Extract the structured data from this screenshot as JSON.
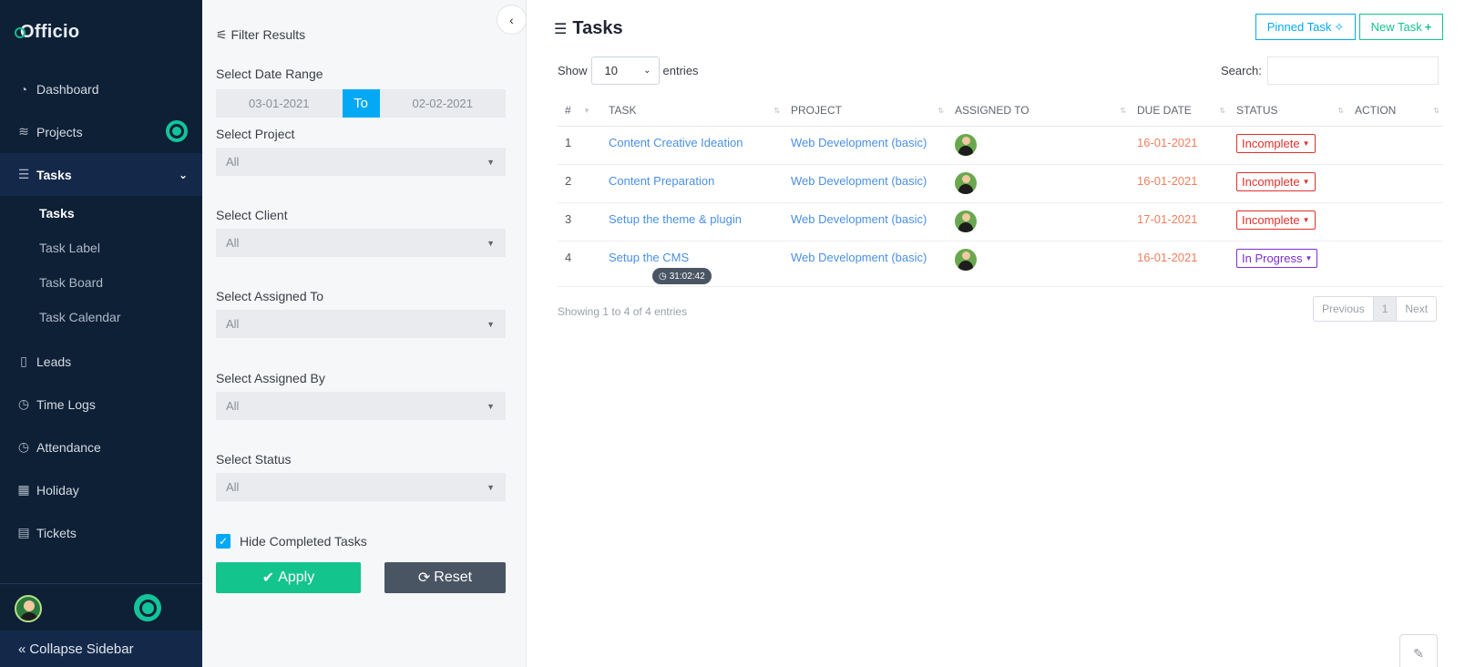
{
  "app": {
    "logo": "Officio"
  },
  "sidebar": {
    "items": [
      {
        "label": "Dashboard",
        "icon": "gauge-icon"
      },
      {
        "label": "Projects",
        "icon": "layers-icon"
      },
      {
        "label": "Tasks",
        "icon": "tasks-icon"
      },
      {
        "label": "Leads",
        "icon": "file-icon"
      },
      {
        "label": "Time Logs",
        "icon": "clock-icon"
      },
      {
        "label": "Attendance",
        "icon": "clock-icon"
      },
      {
        "label": "Holiday",
        "icon": "calendar-icon"
      },
      {
        "label": "Tickets",
        "icon": "ticket-icon"
      }
    ],
    "subitems": [
      "Tasks",
      "Task Label",
      "Task Board",
      "Task Calendar"
    ],
    "collapse_label": "Collapse Sidebar"
  },
  "filter": {
    "title": "Filter Results",
    "date_range_label": "Select Date Range",
    "date_from": "03-01-2021",
    "date_to_label": "To",
    "date_to": "02-02-2021",
    "project_label": "Select Project",
    "project_value": "All",
    "client_label": "Select Client",
    "client_value": "All",
    "assigned_to_label": "Select Assigned To",
    "assigned_to_value": "All",
    "assigned_by_label": "Select Assigned By",
    "assigned_by_value": "All",
    "status_label": "Select Status",
    "status_value": "All",
    "hide_completed_label": "Hide Completed Tasks",
    "apply_label": "Apply",
    "reset_label": "Reset"
  },
  "main": {
    "title": "Tasks",
    "pinned_label": "Pinned Task",
    "new_task_label": "New Task",
    "show_label": "Show",
    "show_value": "10",
    "entries_label": "entries",
    "search_label": "Search:",
    "columns": [
      "#",
      "TASK",
      "PROJECT",
      "ASSIGNED TO",
      "DUE DATE",
      "STATUS",
      "ACTION"
    ],
    "rows": [
      {
        "num": "1",
        "task": "Content Creative Ideation",
        "project": "Web Development (basic)",
        "due": "16-01-2021",
        "status": "Incomplete",
        "status_color": "#e0312c"
      },
      {
        "num": "2",
        "task": "Content Preparation",
        "project": "Web Development (basic)",
        "due": "16-01-2021",
        "status": "Incomplete",
        "status_color": "#e0312c"
      },
      {
        "num": "3",
        "task": "Setup the theme & plugin",
        "project": "Web Development (basic)",
        "due": "17-01-2021",
        "status": "Incomplete",
        "status_color": "#e0312c"
      },
      {
        "num": "4",
        "task": "Setup the CMS",
        "project": "Web Development (basic)",
        "due": "16-01-2021",
        "status": "In Progress",
        "status_color": "#7a2fd1",
        "timer": "31:02:42"
      }
    ],
    "footer_info": "Showing 1 to 4 of 4 entries",
    "pager": {
      "previous": "Previous",
      "current": "1",
      "next": "Next"
    }
  },
  "colors": {
    "accent": "#03a9f4",
    "success": "#14c48d",
    "sidebar_bg": "#0e2036"
  }
}
